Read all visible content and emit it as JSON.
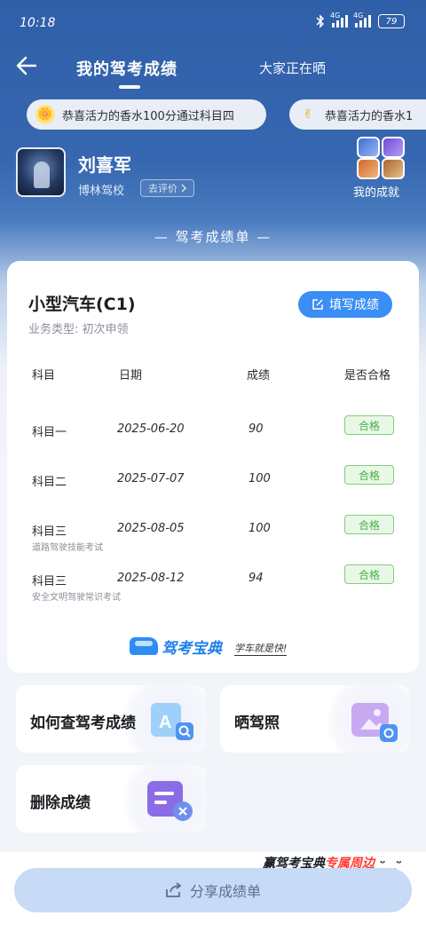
{
  "status_bar": {
    "time": "10:18",
    "battery": "79",
    "net1": "4G",
    "net2": "4G"
  },
  "nav": {
    "tab_active": "我的驾考成绩",
    "tab_other": "大家正在晒"
  },
  "ticker": [
    {
      "emoji": "🌼",
      "text": "恭喜活力的香水100分通过科目四"
    },
    {
      "emoji": "✌",
      "text": "恭喜活力的香水1"
    }
  ],
  "profile": {
    "name": "刘喜军",
    "school": "博林驾校",
    "rate_label": "去评价",
    "achievements_label": "我的成就"
  },
  "sheet_title": "— 驾考成绩单 —",
  "card": {
    "car_type": "小型汽车(C1)",
    "business": "业务类型: 初次申领",
    "fill_button": "填写成绩",
    "headers": {
      "subject": "科目",
      "date": "日期",
      "score": "成绩",
      "passed": "是否合格"
    },
    "rows": [
      {
        "subject": "科目一",
        "date": "2025-06-20",
        "score": "90",
        "result": "合格",
        "note": ""
      },
      {
        "subject": "科目二",
        "date": "2025-07-07",
        "score": "100",
        "result": "合格",
        "note": ""
      },
      {
        "subject": "科目三",
        "date": "2025-08-05",
        "score": "100",
        "result": "合格",
        "note": "道路驾驶技能考试"
      },
      {
        "subject": "科目三",
        "date": "2025-08-12",
        "score": "94",
        "result": "合格",
        "note": "安全文明驾驶常识考试"
      }
    ],
    "brand_name": "驾考宝典",
    "brand_slogan": "学车就是快!"
  },
  "tiles": {
    "how_to_check": "如何查驾考成绩",
    "show_license": "晒驾照",
    "delete_scores": "删除成绩"
  },
  "promo": {
    "part1": "赢驾考宝典",
    "part2": "专属周边"
  },
  "share_button": "分享成绩单",
  "colors": {
    "primary_blue": "#3a8ef5",
    "pass_green": "#47b04a",
    "header_blue": "#2f5fa8"
  }
}
